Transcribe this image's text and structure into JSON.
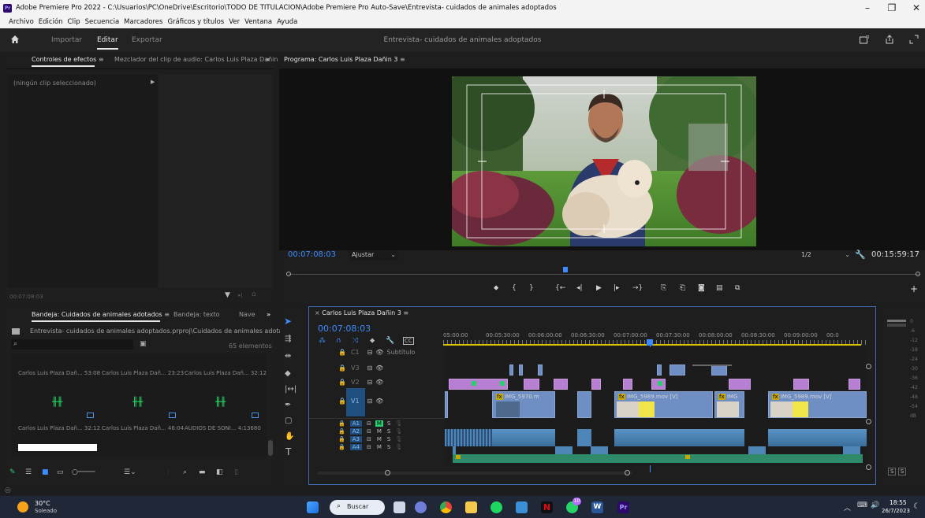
{
  "window": {
    "title": "Adobe Premiere Pro 2022 - C:\\Usuarios\\PC\\OneDrive\\Escritorio\\TODO DE TITULACION\\Adobe Premiere Pro Auto-Save\\Entrevista- cuidados de animales adoptados",
    "app_icon": "Pr",
    "minimize": "–",
    "restore": "❐",
    "close": "✕"
  },
  "menu": [
    "Archivo",
    "Edición",
    "Clip",
    "Secuencia",
    "Marcadores",
    "Gráficos y títulos",
    "Ver",
    "Ventana",
    "Ayuda"
  ],
  "header": {
    "nav": [
      "Importar",
      "Editar",
      "Exportar"
    ],
    "active_nav": "Editar",
    "project_title": "Entrevista- cuidados de animales adoptados"
  },
  "effects_panel": {
    "tab_effects": "Controles de efectos",
    "tab_audio_mixer": "Mezclador del clip de audio: Carlos Luis Plaza Dañin",
    "no_clip": "(ningún clip seleccionado)",
    "timecode": "00:07:08:03"
  },
  "program_monitor": {
    "tab": "Programa: Carlos Luis Plaza Dañin 3",
    "timecode": "00:07:08:03",
    "fit": "Ajustar",
    "resolution": "1/2",
    "duration": "00:15:59:17"
  },
  "project_panel": {
    "tab_bin": "Bandeja: Cuidados de animales adotados",
    "tab_text": "Bandeja: texto",
    "tab_nav": "Nave",
    "path": "Entrevista- cuidados de animales adoptados.prproj\\Cuidados de animales adotados",
    "count": "65 elementos",
    "items_row1": [
      {
        "name": "Carlos Luis Plaza Dañ...",
        "dur": "53:08"
      },
      {
        "name": "Carlos Luis Plaza Dañ...",
        "dur": "23:23"
      },
      {
        "name": "Carlos Luis Plaza Dañ...",
        "dur": "32:12"
      }
    ],
    "items_row2": [
      {
        "name": "Carlos Luis Plaza Dañ...",
        "dur": "32:12"
      },
      {
        "name": "Carlos Luis Plaza Dañ...",
        "dur": "46:04"
      },
      {
        "name": "AUDIOS DE SONI...",
        "dur": "4:13680"
      }
    ]
  },
  "timeline": {
    "tab": "Carlos Luis Plaza Dañin 3",
    "timecode": "00:07:08:03",
    "ruler": [
      "05:00:00",
      "00:05:30:00",
      "00:06:00:00",
      "00:06:30:00",
      "00:07:00:00",
      "00:07:30:00",
      "00:08:00:00",
      "00:08:30:00",
      "00:09:00:00",
      "00:0"
    ],
    "subtitle_label": "Subtítulo",
    "video_tracks": [
      "V3",
      "V2",
      "V1"
    ],
    "audio_tracks": [
      "A1",
      "A2",
      "A3",
      "A4"
    ],
    "track_c": "C1",
    "clip_labels": [
      "IMG_5970.m",
      "IMG_5989.mov [V]",
      "IMG",
      "IMG_5989.mov [V]"
    ],
    "mute": "M",
    "solo": "S",
    "fx": "fx"
  },
  "meter": {
    "scale": [
      "0",
      "-6",
      "-12",
      "-18",
      "-24",
      "-30",
      "-36",
      "-42",
      "-48",
      "-54",
      "dB"
    ],
    "solo_l": "S",
    "solo_r": "S"
  },
  "taskbar": {
    "weather_temp": "30°C",
    "weather_desc": "Soleado",
    "search": "Buscar",
    "time": "18:55",
    "date": "26/7/2023",
    "badge": "10",
    "word": "W",
    "pr": "Pr",
    "netflix": "N"
  }
}
